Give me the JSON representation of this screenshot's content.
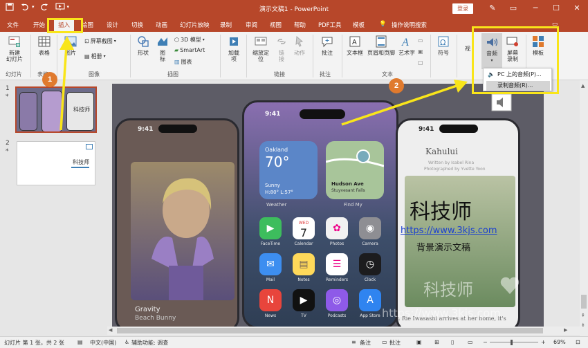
{
  "window": {
    "title": "演示文稿1 - PowerPoint",
    "login": "登录",
    "controls": {
      "ribbon_display": "▭",
      "minimize": "─",
      "maximize": "☐",
      "close": "✕"
    }
  },
  "menu": {
    "tabs": [
      "文件",
      "开始",
      "插入",
      "绘图",
      "设计",
      "切换",
      "动画",
      "幻灯片放映",
      "录制",
      "审阅",
      "视图",
      "帮助",
      "PDF工具",
      "模板"
    ],
    "search": "操作说明搜索",
    "active": "插入"
  },
  "ribbon": {
    "groups": {
      "slides": "幻灯片",
      "tables": "表格",
      "images": "图像",
      "illustrations": "插图",
      "links": "链接",
      "comments": "批注",
      "text": "文本"
    },
    "buttons": {
      "new_slide": "新建\n幻灯片",
      "table": "表格",
      "images": "图片",
      "screenshot": "屏幕截图",
      "album": "相册",
      "shapes": "形状",
      "icons": "图\n标",
      "model3d": "3D 模型",
      "smartart": "SmartArt",
      "chart": "图表",
      "addins": "加载\n项",
      "zoom": "缩放定\n位",
      "link": "链\n接",
      "action": "动作",
      "comment": "批注",
      "textbox": "文本框",
      "header_footer": "页眉和页脚",
      "wordart": "艺术字",
      "symbol": "符号",
      "video": "视",
      "audio": "音频",
      "screen_record": "屏幕\n录制",
      "template": "模板"
    }
  },
  "audio_menu": {
    "items": [
      "PC 上的音频(P)...",
      "录制音频(R)..."
    ]
  },
  "thumbnails": {
    "slide1_num": "1",
    "slide2_num": "2",
    "slide1_star": "*",
    "slide2_star": "*",
    "slide2_title": "科技师"
  },
  "slide": {
    "title": "科技师",
    "url": "https://www.3kjs.com",
    "subtitle": "背景演示文稿",
    "phone_left": {
      "time": "9:41",
      "caption1": "Gravity",
      "caption2": "Beach Bunny"
    },
    "phone_center": {
      "time": "9:41",
      "weather_city": "Oakland",
      "weather_temp": "70°",
      "weather_desc": "Sunny",
      "weather_hl": "H:80° L:57°",
      "widget1": "Weather",
      "map_place": "Hudson Ave",
      "map_sub": "Stuyvesant Falls",
      "widget2": "Find My",
      "apps": [
        "FaceTime",
        "Calendar",
        "Photos",
        "Camera",
        "Mail",
        "Notes",
        "Reminders",
        "Clock",
        "News",
        "TV",
        "Podcasts",
        "App Store"
      ],
      "cal_day": "WED",
      "cal_date": "7"
    },
    "phone_right": {
      "time": "9:41",
      "book_title": "Kahului",
      "written_by": "Written by Isabel Rina",
      "photographed_by": "Photographed by Yvette Yoon",
      "footer_text": "n Rie Iwasashi arrives at her home, it's"
    }
  },
  "watermark": {
    "brand": "科技师",
    "url": "https://www.3kjs.com"
  },
  "annotations": {
    "badge1": "1",
    "badge2": "2"
  },
  "statusbar": {
    "slide_info": "幻灯片 第 1 张，共 2 张",
    "language": "中文(中国)",
    "accessibility": "辅助功能: 调查",
    "notes": "备注",
    "comments": "批注",
    "zoom": "69%"
  },
  "colors": {
    "accent": "#b7472a",
    "highlight": "#f9e51a",
    "badge": "#e07a2e"
  }
}
